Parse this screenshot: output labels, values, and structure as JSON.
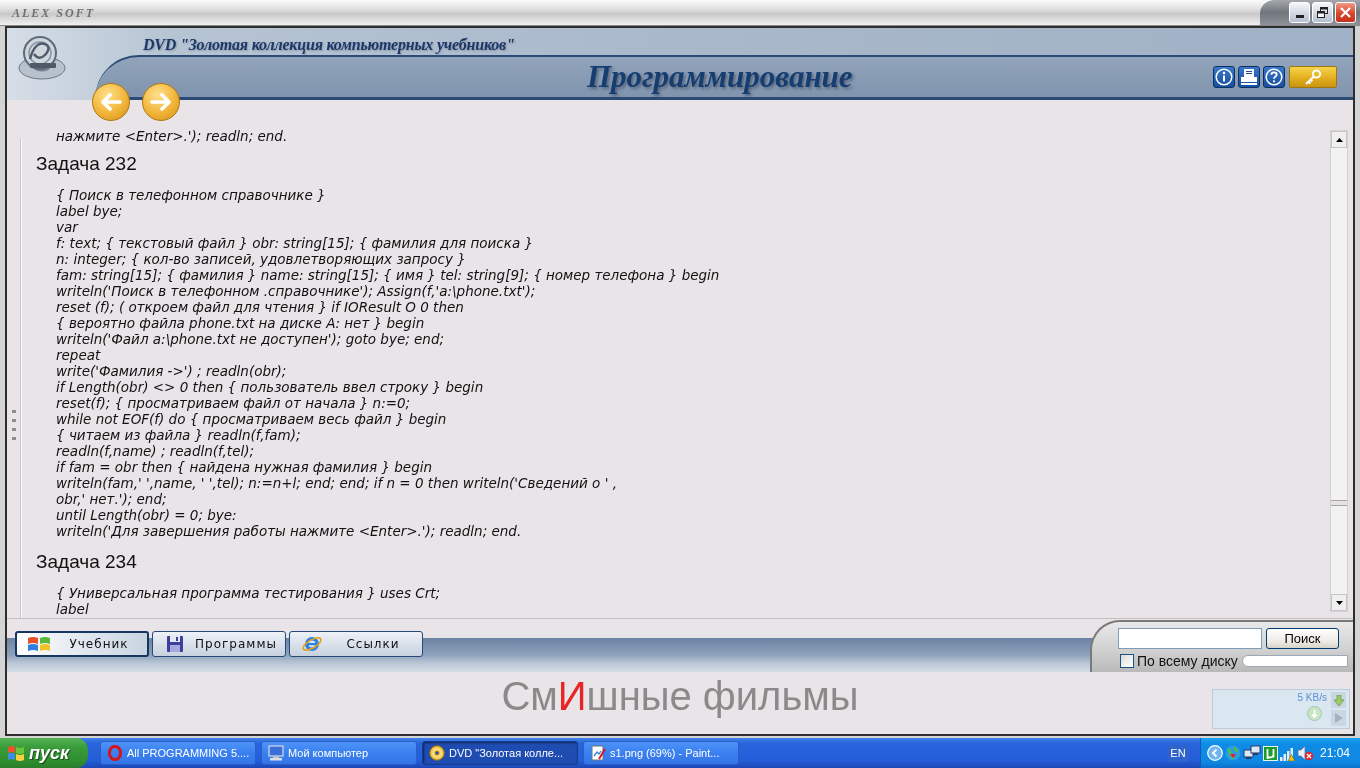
{
  "window": {
    "title": "ALEX SOFT"
  },
  "header": {
    "subtitle": "DVD \"Золотая коллекция компьютерных учебников\"",
    "title": "Программирование"
  },
  "content": {
    "leading_code_lines": [
      "нажмите <Enter>.'); readln; end."
    ],
    "tasks": [
      {
        "heading": "Задача 232",
        "code_lines": [
          "{ Поиск в телефонном справочнике }",
          "label bye;",
          "var",
          "f: text; { текстовый файл } obr: string[15]; { фамилия для поиска }",
          "n: integer; { кол-во записей, удовлетворяющих запросу }",
          "fam: string[15]; { фамилия } name: string[15]; { имя } tel: string[9]; { номер телефона } begin",
          "writeln('Поиск в телефонном .справочнике'); Assign(f,'a:\\phone.txt');",
          "reset (f); ( откроем файл для чтения } if IOResult O 0 then",
          "{ вероятно файла phone.txt на диске А: нет } begin",
          "writeln('Файл a:\\phone.txt не доступен'); goto bye; end;",
          "repeat",
          "write('Фамилия ->') ; readln(obr);",
          "if Length(obr) <> 0 then { пользователь ввел строку } begin",
          "reset(f); { просматриваем файл от начала } n:=0;",
          "while not EOF(f) do { просматриваем весь файл } begin",
          "{ читаем из файла } readln(f,fam);",
          "readln(f,name) ; readln(f,tel);",
          "if fam = obr then { найдена нужная фамилия } begin",
          "writeln(fam,' ',name, ' ',tel); n:=n+l; end; end; if n = 0 then writeln('Сведений о ' ,",
          "obr,' нет.'); end;",
          "until Length(obr) = 0; bye:",
          "writeln('Для завершения работы нажмите <Enter>.'); readln; end."
        ]
      },
      {
        "heading": "Задача 234",
        "code_lines": [
          "{ Универсальная программа тестирования } uses Crt;",
          "label"
        ]
      }
    ]
  },
  "tabs": [
    {
      "label": "Учебник",
      "selected": true
    },
    {
      "label": "Программы",
      "selected": false
    },
    {
      "label": "Ссылки",
      "selected": false
    }
  ],
  "search": {
    "button": "Поиск",
    "option": {
      "label": "По всему диску",
      "checked": false
    }
  },
  "ad_text": [
    {
      "text": "См",
      "color": "#8a8a8a"
    },
    {
      "text": "И",
      "color": "#e82424"
    },
    {
      "text": "шные фильмы",
      "color": "#8a8a8a"
    }
  ],
  "speed_widget": {
    "reading": "5 KB/s"
  },
  "taskbar": {
    "start": "пуск",
    "tasks": [
      {
        "label": "All PROGRAMMING 5....",
        "selected": false
      },
      {
        "label": "Мой компьютер",
        "selected": false
      },
      {
        "label": "DVD \"Золотая колле...",
        "selected": true
      },
      {
        "label": "s1.png (69%) - Paint...",
        "selected": false
      }
    ],
    "language": "EN",
    "clock": "21:04"
  }
}
